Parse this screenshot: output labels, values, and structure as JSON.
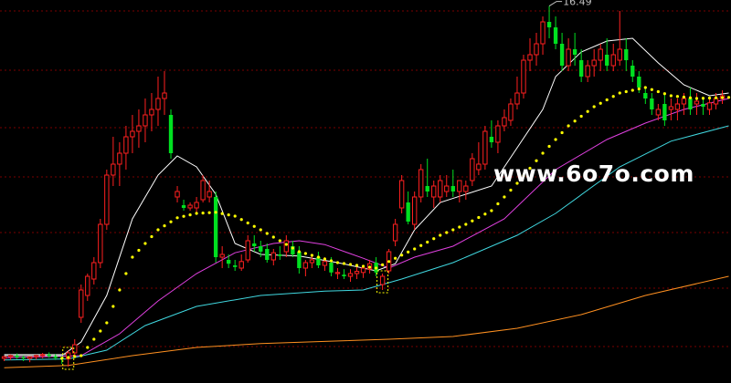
{
  "chart_data": {
    "type": "candlestick",
    "title": "",
    "y_range": [
      9.6,
      16.6
    ],
    "grid": true,
    "peak_annotation": {
      "value": 16.49,
      "label": "16.49",
      "index": 85
    },
    "watermark": "www.6o7o.com",
    "colors": {
      "up": "#ff2020",
      "down": "#00e020",
      "grid": "#7a0000",
      "ma_short": "#ffffff",
      "ma_dots": "#ffff00",
      "ma_mid": "#e040e0",
      "ma_long": "#40d8e0",
      "ma_longest": "#ff9020",
      "flat_line": "#d0d0d0"
    },
    "series": [
      {
        "name": "",
        "kind": "ohlc",
        "values": [
          [
            10.05,
            10.1,
            10.0,
            10.08
          ],
          [
            10.08,
            10.12,
            10.02,
            10.1
          ],
          [
            10.1,
            10.14,
            10.04,
            10.07
          ],
          [
            10.07,
            10.1,
            10.0,
            10.05
          ],
          [
            10.05,
            10.09,
            9.98,
            10.08
          ],
          [
            10.08,
            10.12,
            10.03,
            10.1
          ],
          [
            10.1,
            10.15,
            10.05,
            10.12
          ],
          [
            10.12,
            10.16,
            10.06,
            10.09
          ],
          [
            10.09,
            10.13,
            10.02,
            10.06
          ],
          [
            10.06,
            10.1,
            9.95,
            10.04
          ],
          [
            10.04,
            10.2,
            9.9,
            10.15
          ],
          [
            10.15,
            10.4,
            10.1,
            10.3
          ],
          [
            10.8,
            11.4,
            10.7,
            11.3
          ],
          [
            11.2,
            11.6,
            11.1,
            11.55
          ],
          [
            11.5,
            11.9,
            11.4,
            11.8
          ],
          [
            11.8,
            12.6,
            11.7,
            12.5
          ],
          [
            12.5,
            13.5,
            12.4,
            13.4
          ],
          [
            13.4,
            14.1,
            13.2,
            13.6
          ],
          [
            13.6,
            14.0,
            13.2,
            13.8
          ],
          [
            13.8,
            14.3,
            13.5,
            14.1
          ],
          [
            14.1,
            14.5,
            13.8,
            14.2
          ],
          [
            14.2,
            14.6,
            13.9,
            14.3
          ],
          [
            14.3,
            14.8,
            14.0,
            14.5
          ],
          [
            14.5,
            14.9,
            14.2,
            14.6
          ],
          [
            14.6,
            15.2,
            14.3,
            14.8
          ],
          [
            14.8,
            15.3,
            14.5,
            14.9
          ],
          [
            14.5,
            14.6,
            13.7,
            13.8
          ],
          [
            13.0,
            13.2,
            12.9,
            13.1
          ],
          [
            12.85,
            12.95,
            12.75,
            12.8
          ],
          [
            12.8,
            12.9,
            12.75,
            12.85
          ],
          [
            12.8,
            13.0,
            12.7,
            12.9
          ],
          [
            12.95,
            13.4,
            12.9,
            13.3
          ],
          [
            13.0,
            13.3,
            12.9,
            13.1
          ],
          [
            13.0,
            13.1,
            11.8,
            11.9
          ],
          [
            11.9,
            12.1,
            11.7,
            11.95
          ],
          [
            11.85,
            11.95,
            11.7,
            11.78
          ],
          [
            11.75,
            11.85,
            11.65,
            11.72
          ],
          [
            11.7,
            11.95,
            11.65,
            11.82
          ],
          [
            11.85,
            12.3,
            11.8,
            12.2
          ],
          [
            12.15,
            12.3,
            12.0,
            12.1
          ],
          [
            12.1,
            12.2,
            11.9,
            12.0
          ],
          [
            12.05,
            12.15,
            11.8,
            11.85
          ],
          [
            11.85,
            12.05,
            11.75,
            11.98
          ],
          [
            11.95,
            12.1,
            11.85,
            11.92
          ],
          [
            12.0,
            12.3,
            11.9,
            12.2
          ],
          [
            12.1,
            12.2,
            11.9,
            11.95
          ],
          [
            12.0,
            12.1,
            11.6,
            11.7
          ],
          [
            11.7,
            11.85,
            11.55,
            11.8
          ],
          [
            11.8,
            11.95,
            11.7,
            11.85
          ],
          [
            11.9,
            12.0,
            11.7,
            11.75
          ],
          [
            11.75,
            11.9,
            11.65,
            11.82
          ],
          [
            11.8,
            11.9,
            11.55,
            11.62
          ],
          [
            11.6,
            11.7,
            11.5,
            11.62
          ],
          [
            11.58,
            11.68,
            11.5,
            11.55
          ],
          [
            11.55,
            11.68,
            11.45,
            11.6
          ],
          [
            11.6,
            11.72,
            11.5,
            11.64
          ],
          [
            11.62,
            11.75,
            11.52,
            11.7
          ],
          [
            11.68,
            11.85,
            11.6,
            11.78
          ],
          [
            11.8,
            11.9,
            11.55,
            11.62
          ],
          [
            11.4,
            11.6,
            11.3,
            11.55
          ],
          [
            11.65,
            12.05,
            11.6,
            12.0
          ],
          [
            12.2,
            12.6,
            12.1,
            12.5
          ],
          [
            12.8,
            13.4,
            12.7,
            13.3
          ],
          [
            12.9,
            13.1,
            12.5,
            12.55
          ],
          [
            12.5,
            13.1,
            12.4,
            13.0
          ],
          [
            13.0,
            13.6,
            12.9,
            13.5
          ],
          [
            13.2,
            13.7,
            13.0,
            13.1
          ],
          [
            13.0,
            13.3,
            12.8,
            13.2
          ],
          [
            13.0,
            13.4,
            12.9,
            13.3
          ],
          [
            13.1,
            13.4,
            13.0,
            13.2
          ],
          [
            13.2,
            13.5,
            13.0,
            13.1
          ],
          [
            13.1,
            13.3,
            12.9,
            13.3
          ],
          [
            13.1,
            13.3,
            12.95,
            13.2
          ],
          [
            13.3,
            13.8,
            13.2,
            13.7
          ],
          [
            13.5,
            14.0,
            13.4,
            13.6
          ],
          [
            13.6,
            14.3,
            13.5,
            14.2
          ],
          [
            14.1,
            14.4,
            13.9,
            14.0
          ],
          [
            14.0,
            14.4,
            13.8,
            14.3
          ],
          [
            14.3,
            14.6,
            14.2,
            14.45
          ],
          [
            14.4,
            14.8,
            14.3,
            14.7
          ],
          [
            14.7,
            15.2,
            14.6,
            14.9
          ],
          [
            14.9,
            15.6,
            14.8,
            15.5
          ],
          [
            15.5,
            15.9,
            15.3,
            15.6
          ],
          [
            15.6,
            16.0,
            15.4,
            15.8
          ],
          [
            15.8,
            16.3,
            15.6,
            16.2
          ],
          [
            16.2,
            16.49,
            15.9,
            16.1
          ],
          [
            16.1,
            16.3,
            15.7,
            15.8
          ],
          [
            15.8,
            16.0,
            15.3,
            15.4
          ],
          [
            15.4,
            15.9,
            15.3,
            15.7
          ],
          [
            15.7,
            16.0,
            15.4,
            15.6
          ],
          [
            15.5,
            15.7,
            15.1,
            15.2
          ],
          [
            15.2,
            15.5,
            15.1,
            15.4
          ],
          [
            15.4,
            15.7,
            15.2,
            15.5
          ],
          [
            15.5,
            15.8,
            15.3,
            15.7
          ],
          [
            15.6,
            15.9,
            15.3,
            15.4
          ],
          [
            15.4,
            15.8,
            15.3,
            15.6
          ],
          [
            15.5,
            16.4,
            15.4,
            15.7
          ],
          [
            15.7,
            15.9,
            15.3,
            15.5
          ],
          [
            15.4,
            15.5,
            15.1,
            15.2
          ],
          [
            15.2,
            15.3,
            14.9,
            15.0
          ],
          [
            14.9,
            15.0,
            14.7,
            14.8
          ],
          [
            14.8,
            14.9,
            14.5,
            14.6
          ],
          [
            14.5,
            14.7,
            14.4,
            14.6
          ],
          [
            14.7,
            14.9,
            14.3,
            14.4
          ],
          [
            14.6,
            14.8,
            14.4,
            14.65
          ],
          [
            14.6,
            14.8,
            14.4,
            14.7
          ],
          [
            14.7,
            14.9,
            14.5,
            14.8
          ],
          [
            14.8,
            15.0,
            14.5,
            14.6
          ],
          [
            14.7,
            14.9,
            14.5,
            14.75
          ],
          [
            14.7,
            14.8,
            14.5,
            14.65
          ],
          [
            14.6,
            14.8,
            14.5,
            14.72
          ],
          [
            14.7,
            14.9,
            14.6,
            14.8
          ],
          [
            14.8,
            14.95,
            14.7,
            14.85
          ]
        ]
      },
      {
        "name": "",
        "kind": "line",
        "color_key": "ma_longest",
        "points": [
          [
            0,
            9.88
          ],
          [
            10,
            9.92
          ],
          [
            20,
            10.1
          ],
          [
            30,
            10.25
          ],
          [
            40,
            10.32
          ],
          [
            50,
            10.36
          ],
          [
            60,
            10.4
          ],
          [
            70,
            10.45
          ],
          [
            80,
            10.6
          ],
          [
            90,
            10.85
          ],
          [
            100,
            11.2
          ],
          [
            113,
            11.55
          ]
        ]
      },
      {
        "name": "",
        "kind": "line",
        "color_key": "ma_long",
        "points": [
          [
            0,
            10.02
          ],
          [
            10,
            10.04
          ],
          [
            16,
            10.2
          ],
          [
            22,
            10.65
          ],
          [
            30,
            11.0
          ],
          [
            40,
            11.2
          ],
          [
            50,
            11.28
          ],
          [
            56,
            11.3
          ],
          [
            62,
            11.5
          ],
          [
            70,
            11.8
          ],
          [
            80,
            12.3
          ],
          [
            86,
            12.7
          ],
          [
            96,
            13.55
          ],
          [
            104,
            14.02
          ],
          [
            113,
            14.3
          ]
        ]
      },
      {
        "name": "",
        "kind": "line",
        "color_key": "ma_mid",
        "points": [
          [
            0,
            10.06
          ],
          [
            12,
            10.1
          ],
          [
            18,
            10.5
          ],
          [
            24,
            11.1
          ],
          [
            30,
            11.6
          ],
          [
            36,
            11.98
          ],
          [
            42,
            12.15
          ],
          [
            46,
            12.2
          ],
          [
            50,
            12.13
          ],
          [
            56,
            11.88
          ],
          [
            60,
            11.7
          ],
          [
            64,
            11.9
          ],
          [
            70,
            12.1
          ],
          [
            78,
            12.6
          ],
          [
            86,
            13.5
          ],
          [
            94,
            14.05
          ],
          [
            100,
            14.35
          ],
          [
            106,
            14.6
          ],
          [
            113,
            14.8
          ]
        ]
      },
      {
        "name": "",
        "kind": "line",
        "color_key": "ma_short",
        "points": [
          [
            0,
            10.1
          ],
          [
            9,
            10.1
          ],
          [
            12,
            10.35
          ],
          [
            16,
            11.2
          ],
          [
            20,
            12.6
          ],
          [
            24,
            13.4
          ],
          [
            27,
            13.75
          ],
          [
            30,
            13.55
          ],
          [
            33,
            13.05
          ],
          [
            36,
            12.15
          ],
          [
            40,
            11.95
          ],
          [
            46,
            11.92
          ],
          [
            52,
            11.8
          ],
          [
            58,
            11.65
          ],
          [
            61,
            11.78
          ],
          [
            64,
            12.4
          ],
          [
            68,
            12.9
          ],
          [
            72,
            13.05
          ],
          [
            76,
            13.2
          ],
          [
            80,
            13.9
          ],
          [
            84,
            14.6
          ],
          [
            86,
            15.2
          ],
          [
            90,
            15.65
          ],
          [
            94,
            15.85
          ],
          [
            98,
            15.9
          ],
          [
            102,
            15.45
          ],
          [
            106,
            15.05
          ],
          [
            110,
            14.85
          ],
          [
            113,
            14.9
          ]
        ]
      },
      {
        "name": "",
        "kind": "dotted",
        "color_key": "ma_dots",
        "points": [
          [
            9,
            10.05
          ],
          [
            12,
            10.1
          ],
          [
            16,
            10.7
          ],
          [
            20,
            11.9
          ],
          [
            24,
            12.4
          ],
          [
            27,
            12.62
          ],
          [
            30,
            12.7
          ],
          [
            33,
            12.72
          ],
          [
            36,
            12.65
          ],
          [
            40,
            12.4
          ],
          [
            46,
            12.0
          ],
          [
            52,
            11.8
          ],
          [
            58,
            11.7
          ],
          [
            61,
            11.88
          ],
          [
            64,
            12.05
          ],
          [
            68,
            12.3
          ],
          [
            72,
            12.5
          ],
          [
            76,
            12.75
          ],
          [
            80,
            13.25
          ],
          [
            84,
            13.8
          ],
          [
            88,
            14.3
          ],
          [
            92,
            14.65
          ],
          [
            96,
            14.9
          ],
          [
            100,
            15.0
          ],
          [
            104,
            14.85
          ],
          [
            108,
            14.8
          ],
          [
            113,
            14.82
          ]
        ]
      },
      {
        "name": "",
        "kind": "line",
        "color_key": "flat_line",
        "points": [
          [
            0,
            10.12
          ],
          [
            10,
            10.12
          ]
        ]
      }
    ],
    "highlight_boxes": [
      10,
      59
    ]
  }
}
